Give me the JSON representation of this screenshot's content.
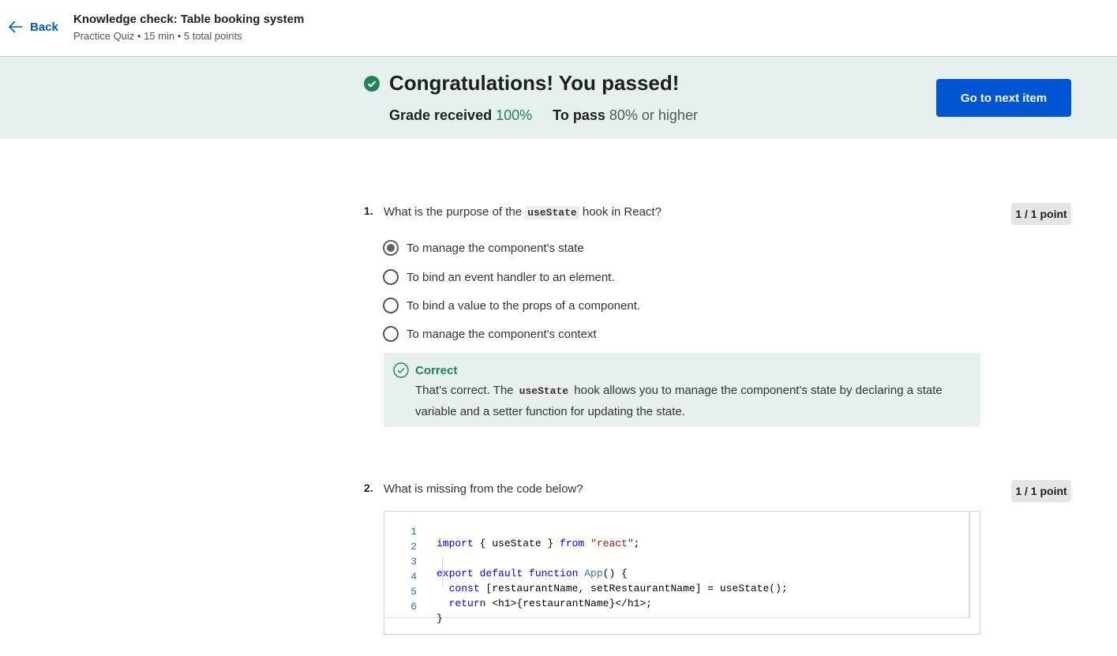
{
  "header": {
    "back_label": "Back",
    "title": "Knowledge check: Table booking system",
    "meta": "Practice Quiz • 15 min • 5 total points"
  },
  "result": {
    "headline": "Congratulations! You passed!",
    "grade_label": "Grade received",
    "grade_value": "100%",
    "pass_label": "To pass",
    "pass_value": "80% or higher",
    "next_button": "Go to next item",
    "accent_color": "#1f8354",
    "button_color": "#0056d2"
  },
  "questions": [
    {
      "number": "1.",
      "text_before": "What is the purpose of the",
      "code": "useState",
      "text_after": "hook in React?",
      "points": "1 / 1 point",
      "options": [
        {
          "label": "To manage the component's state",
          "selected": true
        },
        {
          "label": "To bind an event handler to an element.",
          "selected": false
        },
        {
          "label": "To bind a value to the props of a component.",
          "selected": false
        },
        {
          "label": "To manage the component's context",
          "selected": false
        }
      ],
      "feedback": {
        "title": "Correct",
        "text_before": "That’s correct. The",
        "code": "useState",
        "text_after": "hook allows you to manage the component's state by declaring a state variable and a setter function for updating the state."
      }
    },
    {
      "number": "2.",
      "text": "What is missing from the code below?",
      "points": "1 / 1 point",
      "code_lines": [
        {
          "n": "1",
          "text": "import { useState } from \"react\";"
        },
        {
          "n": "2",
          "text": ""
        },
        {
          "n": "3",
          "text": "export default function App() {"
        },
        {
          "n": "4",
          "text": "  const [restaurantName, setRestaurantName] = useState();"
        },
        {
          "n": "5",
          "text": "  return <h1>{restaurantName}</h1>;"
        },
        {
          "n": "6",
          "text": "}"
        }
      ]
    }
  ]
}
